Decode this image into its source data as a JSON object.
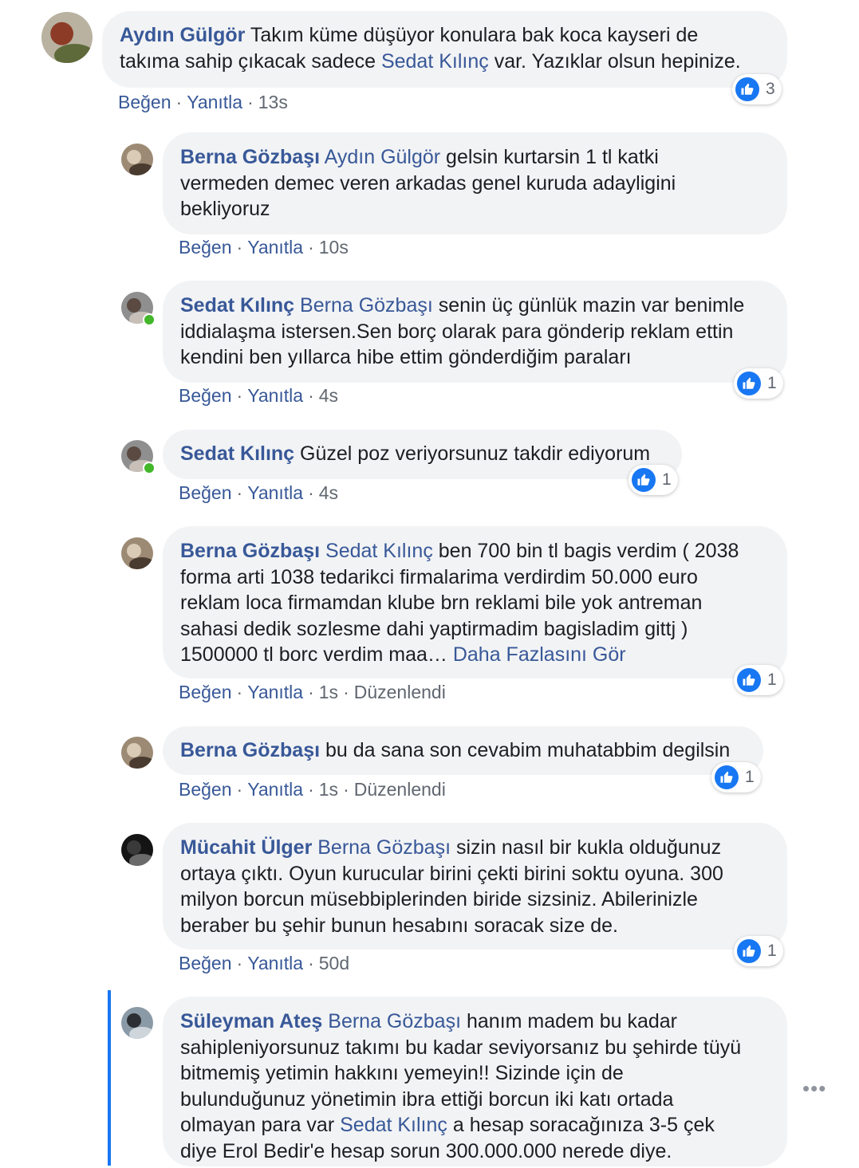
{
  "actions": {
    "like": "Beğen",
    "reply": "Yanıtla",
    "edited": "Düzenlendi"
  },
  "more_options": "•••",
  "colors": {
    "name": "#385898",
    "bubble": "#f2f3f5",
    "like": "#1877f2",
    "online": "#42b72a",
    "thread": "#1877f2"
  },
  "comments": [
    {
      "name": "Aydın Gülgör",
      "lines": [
        [
          {
            "t": "Takım küme düşüyor konulara bak koca kayseri de"
          }
        ],
        [
          {
            "t": "takıma sahip çıkacak sadece "
          },
          {
            "t": "Sedat Kılınç",
            "m": true
          },
          {
            "t": " var. Yazıklar olsun hepinize."
          }
        ]
      ],
      "time": "13s",
      "reactions": "3",
      "edited": false
    },
    {
      "name": "Berna Gözbaşı",
      "lines": [
        [
          {
            "t": "Aydın Gülgör",
            "m": true
          },
          {
            "t": " gelsin kurtarsin 1 tl katki"
          }
        ],
        [
          {
            "t": "vermeden demec veren arkadas genel kuruda adayligini"
          }
        ],
        [
          {
            "t": "bekliyoruz"
          }
        ]
      ],
      "time": "10s",
      "reactions": "",
      "edited": false
    },
    {
      "name": "Sedat Kılınç",
      "lines": [
        [
          {
            "t": "Berna Gözbaşı",
            "m": true
          },
          {
            "t": " senin üç günlük mazin var benimle"
          }
        ],
        [
          {
            "t": "iddialaşma istersen.Sen borç olarak para gönderip reklam ettin"
          }
        ],
        [
          {
            "t": "kendini ben yıllarca hibe ettim gönderdiğim paraları"
          }
        ]
      ],
      "time": "4s",
      "reactions": "1",
      "edited": false
    },
    {
      "name": "Sedat Kılınç",
      "lines": [
        [
          {
            "t": "Güzel poz veriyorsunuz takdir ediyorum"
          }
        ]
      ],
      "time": "4s",
      "reactions": "1",
      "edited": false
    },
    {
      "name": "Berna Gözbaşı",
      "lines": [
        [
          {
            "t": "Sedat Kılınç",
            "m": true
          },
          {
            "t": " ben 700 bin tl bagis verdim ( 2038"
          }
        ],
        [
          {
            "t": "forma arti 1038 tedarikci firmalarima verdirdim 50.000 euro"
          }
        ],
        [
          {
            "t": "reklam loca firmamdan klube brn reklami bile yok antreman"
          }
        ],
        [
          {
            "t": "sahasi dedik sozlesme dahi yaptirmadim bagisladim gittj )"
          }
        ],
        [
          {
            "t": "1500000 tl borc verdim maa… "
          },
          {
            "t": "Daha Fazlasını Gör",
            "m": true
          }
        ]
      ],
      "time": "1s",
      "reactions": "1",
      "edited": true
    },
    {
      "name": "Berna Gözbaşı",
      "lines": [
        [
          {
            "t": "bu da sana son cevabim muhatabbim degilsin"
          }
        ]
      ],
      "time": "1s",
      "reactions": "1",
      "edited": true
    },
    {
      "name": "Mücahit Ülger",
      "lines": [
        [
          {
            "t": "Berna Gözbaşı",
            "m": true
          },
          {
            "t": " sizin nasıl bir kukla olduğunuz"
          }
        ],
        [
          {
            "t": "ortaya çıktı. Oyun kurucular birini çekti birini soktu oyuna. 300"
          }
        ],
        [
          {
            "t": "milyon borcun müsebbiplerinden biride sizsiniz. Abilerinizle"
          }
        ],
        [
          {
            "t": "beraber bu şehir bunun hesabını soracak size de."
          }
        ]
      ],
      "time": "50d",
      "reactions": "1",
      "edited": false
    },
    {
      "name": "Süleyman Ateş",
      "lines": [
        [
          {
            "t": "Berna Gözbaşı",
            "m": true
          },
          {
            "t": " hanım madem bu kadar"
          }
        ],
        [
          {
            "t": "sahipleniyorsunuz takımı bu kadar seviyorsanız bu şehirde tüyü"
          }
        ],
        [
          {
            "t": "bitmemiş yetimin hakkını yemeyin!! Sizinde için de"
          }
        ],
        [
          {
            "t": "bulunduğunuz yönetimin ibra ettiği borcun iki katı ortada"
          }
        ],
        [
          {
            "t": "olmayan para var "
          },
          {
            "t": "Sedat Kılınç",
            "m": true
          },
          {
            "t": " a hesap soracağınıza 3-5 çek"
          }
        ],
        [
          {
            "t": "diye Erol Bedir'e hesap sorun 300.000.000 nerede diye."
          }
        ]
      ],
      "time": "",
      "reactions": "",
      "edited": false
    }
  ]
}
